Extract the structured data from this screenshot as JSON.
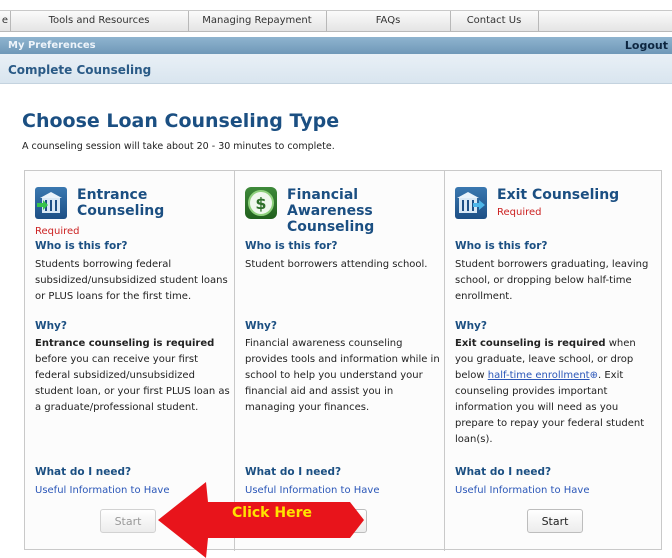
{
  "nav": {
    "tabs": [
      "e",
      "Tools and Resources",
      "Managing Repayment",
      "FAQs",
      "Contact Us"
    ]
  },
  "prefbar": {
    "left": "My Preferences",
    "right": "Logout"
  },
  "breadcrumb": "Complete Counseling",
  "main": {
    "title": "Choose Loan Counseling Type",
    "intro": "A counseling session will take about 20 - 30 minutes to complete."
  },
  "cards": [
    {
      "title_lines": [
        "Entrance",
        "Counseling"
      ],
      "required": "Required",
      "who_heading": "Who is this for?",
      "who_text": "Students borrowing federal subsidized/unsubsidized student loans or PLUS loans for the first time.",
      "why_heading": "Why?",
      "why_bold": "Entrance counseling is required",
      "why_text": "before you can receive your first federal subsidized/unsubsidized student loan, or your first PLUS loan as a graduate/professional student.",
      "need_heading": "What do I need?",
      "link": "Useful Information to Have",
      "button": "Start",
      "icon": "entrance-building-icon"
    },
    {
      "title_lines": [
        "Financial",
        "Awareness",
        "Counseling"
      ],
      "who_heading": "Who is this for?",
      "who_text": "Student borrowers attending school.",
      "why_heading": "Why?",
      "why_text": "Financial awareness counseling provides tools and information while in school to help you understand your financial aid and assist you in managing your finances.",
      "need_heading": "What do I need?",
      "link": "Useful Information to Have",
      "button": "Start",
      "icon": "dollar-coin-icon"
    },
    {
      "title_lines": [
        "Exit Counseling"
      ],
      "required": "Required",
      "who_heading": "Who is this for?",
      "who_text": "Student borrowers graduating, leaving school, or dropping below half-time enrollment.",
      "why_heading": "Why?",
      "why_bold": "Exit counseling is required",
      "why_text_1": "when you graduate, leave school, or drop below",
      "why_link": "half-time enrollment",
      "why_text_2": ". Exit counseling provides important information you will need as you prepare to repay your federal student loan(s).",
      "need_heading": "What do I need?",
      "link": "Useful Information to Have",
      "button": "Start",
      "icon": "exit-building-icon"
    }
  ],
  "annotation": {
    "label": "Click Here",
    "color": "#e8141b"
  }
}
